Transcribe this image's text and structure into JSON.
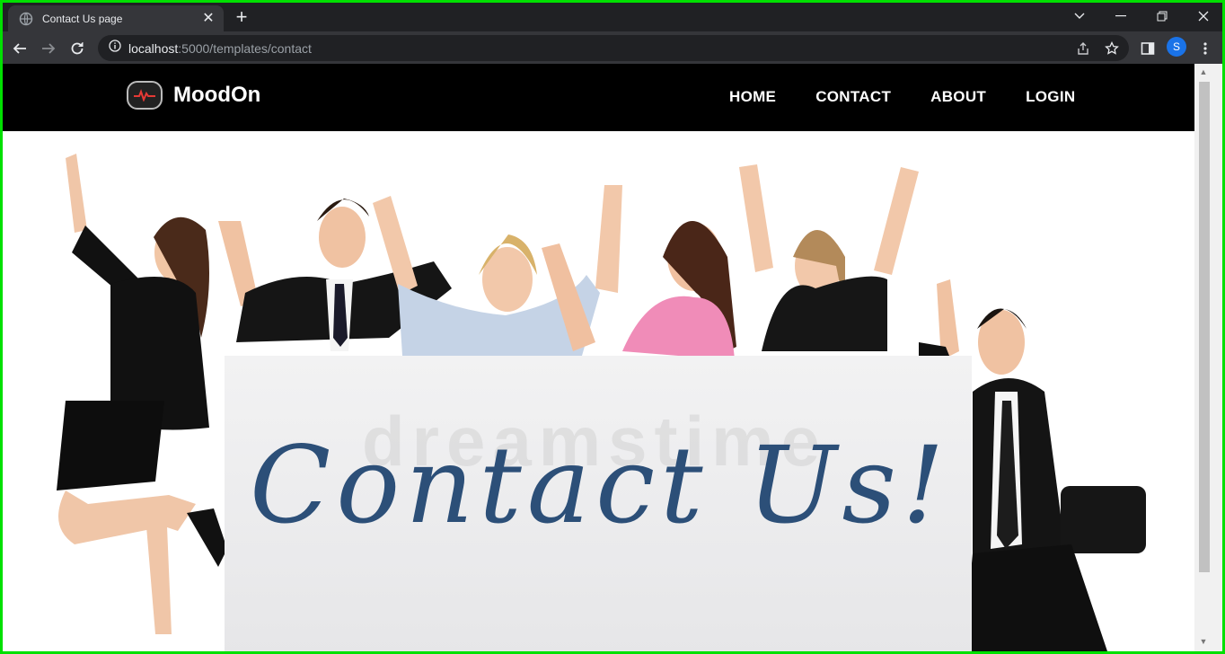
{
  "browser": {
    "tab_title": "Contact Us page",
    "url_host": "localhost",
    "url_path": ":5000/templates/contact",
    "profile_initial": "S"
  },
  "site": {
    "brand": "MoodOn",
    "nav": [
      "HOME",
      "CONTACT",
      "ABOUT",
      "LOGIN"
    ]
  },
  "hero": {
    "headline": "Contact Us!",
    "watermark": "dreamstime"
  },
  "colors": {
    "headline": "#2c4f78",
    "navbar": "#000000",
    "frame_border": "#00e000"
  }
}
